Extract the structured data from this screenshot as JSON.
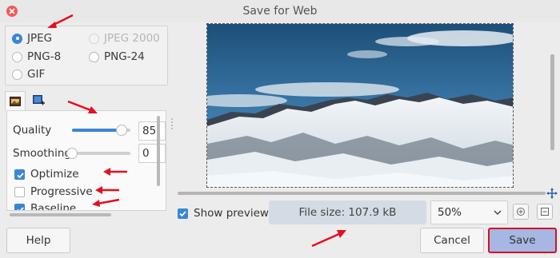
{
  "window": {
    "title": "Save for Web"
  },
  "format": {
    "options": [
      {
        "label": "JPEG",
        "selected": true,
        "enabled": true
      },
      {
        "label": "JPEG 2000",
        "selected": false,
        "enabled": false
      },
      {
        "label": "PNG-8",
        "selected": false,
        "enabled": true
      },
      {
        "label": "PNG-24",
        "selected": false,
        "enabled": true
      },
      {
        "label": "GIF",
        "selected": false,
        "enabled": true
      }
    ]
  },
  "tabs": [
    {
      "icon": "image-settings-icon",
      "active": true
    },
    {
      "icon": "image-add-icon",
      "active": false
    }
  ],
  "settings": {
    "quality_label": "Quality",
    "quality_value": "85",
    "quality_fraction": 0.85,
    "smoothing_label": "Smoothing",
    "smoothing_value": "0",
    "smoothing_fraction": 0,
    "optimize_label": "Optimize",
    "optimize_checked": true,
    "progressive_label": "Progressive",
    "progressive_checked": false,
    "baseline_label": "Baseline",
    "baseline_checked": true
  },
  "preview": {
    "show_preview_label": "Show preview",
    "show_preview_checked": true,
    "file_size": "File size: 107.9 kB",
    "zoom": "50%"
  },
  "buttons": {
    "help": "Help",
    "cancel": "Cancel",
    "save": "Save"
  },
  "colors": {
    "accent": "#3a86d6",
    "annotation": "#e01020",
    "save_highlight": "#a6b7e3"
  }
}
